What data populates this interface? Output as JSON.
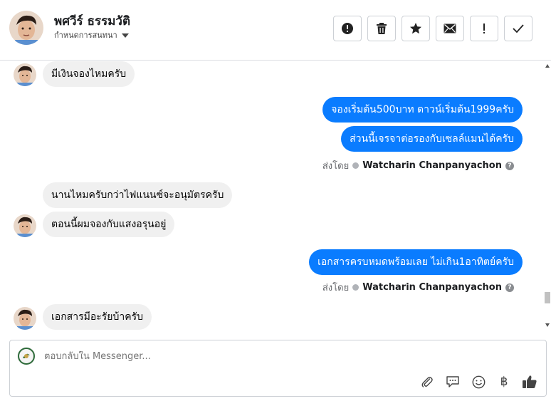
{
  "header": {
    "contact_name": "พศวีร์ ธรรมวัติ",
    "contact_subtitle": "กำหนดการสนทนา",
    "actions": [
      {
        "icon": "alert-circle-icon",
        "label": "Mark as spam"
      },
      {
        "icon": "trash-icon",
        "label": "Delete"
      },
      {
        "icon": "star-icon",
        "label": "Star"
      },
      {
        "icon": "envelope-icon",
        "label": "Mark as unread"
      },
      {
        "icon": "exclamation-icon",
        "label": "Follow up"
      },
      {
        "icon": "check-icon",
        "label": "Mark as done"
      }
    ]
  },
  "messages": [
    {
      "side": "in",
      "text": "มีเงินจองไหมครับ",
      "show_avatar": true
    },
    {
      "side": "out",
      "text": "จองเริ่มต้น500บาท ดาวน์เริ่มต้น1999ครับ"
    },
    {
      "side": "out",
      "text": "ส่วนนี้เจรจาต่อรองกับเซลล์แมนได้ครับ"
    },
    {
      "side": "meta",
      "prefix": "ส่งโดย",
      "sender": "Watcharin Chanpanyachon"
    },
    {
      "side": "in",
      "text": "นานไหมครับกว่าไฟแนนซ์จะอนุมัตรครับ",
      "show_avatar": false
    },
    {
      "side": "in",
      "text": "ตอนนี้ผมจองกับแสงอรุนอยู่",
      "show_avatar": true
    },
    {
      "side": "out",
      "text": "เอกสารครบหมดพร้อมเลย ไม่เกิน1อาทิตย์ครับ"
    },
    {
      "side": "meta",
      "prefix": "ส่งโดย",
      "sender": "Watcharin Chanpanyachon"
    },
    {
      "side": "in",
      "text": "เอกสารมีอะรัยบ้าครับ",
      "show_avatar": true
    }
  ],
  "composer": {
    "placeholder": "ตอบกลับใน Messenger...",
    "tools": [
      "paperclip-icon",
      "speech-bubble-icon",
      "smiley-icon",
      "baht-icon",
      "thumbs-up-icon"
    ],
    "baht_symbol": "฿"
  },
  "colors": {
    "outgoing_bubble": "#0a7cff",
    "incoming_bubble": "#f0f0f0",
    "like_button": "#444444"
  }
}
